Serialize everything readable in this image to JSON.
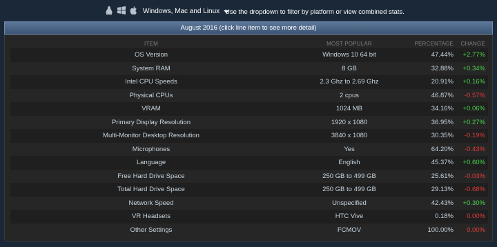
{
  "header": {
    "platform_icons": [
      "linux-icon",
      "windows-icon",
      "apple-icon"
    ],
    "platform_label": "Windows, Mac and Linux",
    "hint": "Use the dropdown to filter by platform or view combined stats."
  },
  "panel": {
    "title": "August 2016 (click line item to see more detail)"
  },
  "table": {
    "columns": [
      "ITEM",
      "MOST POPULAR",
      "PERCENTAGE",
      "CHANGE"
    ],
    "rows": [
      {
        "item": "OS Version",
        "popular": "Windows 10 64 bit",
        "pct": "47.44%",
        "change": "+2.77%",
        "dir": "up"
      },
      {
        "item": "System RAM",
        "popular": "8 GB",
        "pct": "32.88%",
        "change": "+0.34%",
        "dir": "up"
      },
      {
        "item": "Intel CPU Speeds",
        "popular": "2.3 Ghz to 2.69 Ghz",
        "pct": "20.91%",
        "change": "+0.16%",
        "dir": "up"
      },
      {
        "item": "Physical CPUs",
        "popular": "2 cpus",
        "pct": "46.87%",
        "change": "-0.57%",
        "dir": "down"
      },
      {
        "item": "VRAM",
        "popular": "1024 MB",
        "pct": "34.16%",
        "change": "+0.06%",
        "dir": "up"
      },
      {
        "item": "Primary Display Resolution",
        "popular": "1920 x 1080",
        "pct": "36.95%",
        "change": "+0.27%",
        "dir": "up"
      },
      {
        "item": "Multi-Monitor Desktop Resolution",
        "popular": "3840 x 1080",
        "pct": "30.35%",
        "change": "-0.19%",
        "dir": "down"
      },
      {
        "item": "Microphones",
        "popular": "Yes",
        "pct": "64.20%",
        "change": "-0.43%",
        "dir": "down"
      },
      {
        "item": "Language",
        "popular": "English",
        "pct": "45.37%",
        "change": "+0.60%",
        "dir": "up"
      },
      {
        "item": "Free Hard Drive Space",
        "popular": "250 GB to 499 GB",
        "pct": "25.61%",
        "change": "-0.03%",
        "dir": "down"
      },
      {
        "item": "Total Hard Drive Space",
        "popular": "250 GB to 499 GB",
        "pct": "29.13%",
        "change": "-0.68%",
        "dir": "down"
      },
      {
        "item": "Network Speed",
        "popular": "Unspecified",
        "pct": "42.43%",
        "change": "+0.30%",
        "dir": "up"
      },
      {
        "item": "VR Headsets",
        "popular": "HTC Vive",
        "pct": "0.18%",
        "change": "0.00%",
        "dir": "zero"
      },
      {
        "item": "Other Settings",
        "popular": "FCMOV",
        "pct": "100.00%",
        "change": "0.00%",
        "dir": "zero"
      }
    ]
  },
  "colors": {
    "background": "#1b2838",
    "positive": "#4ad34a",
    "negative": "#e23b3b"
  }
}
